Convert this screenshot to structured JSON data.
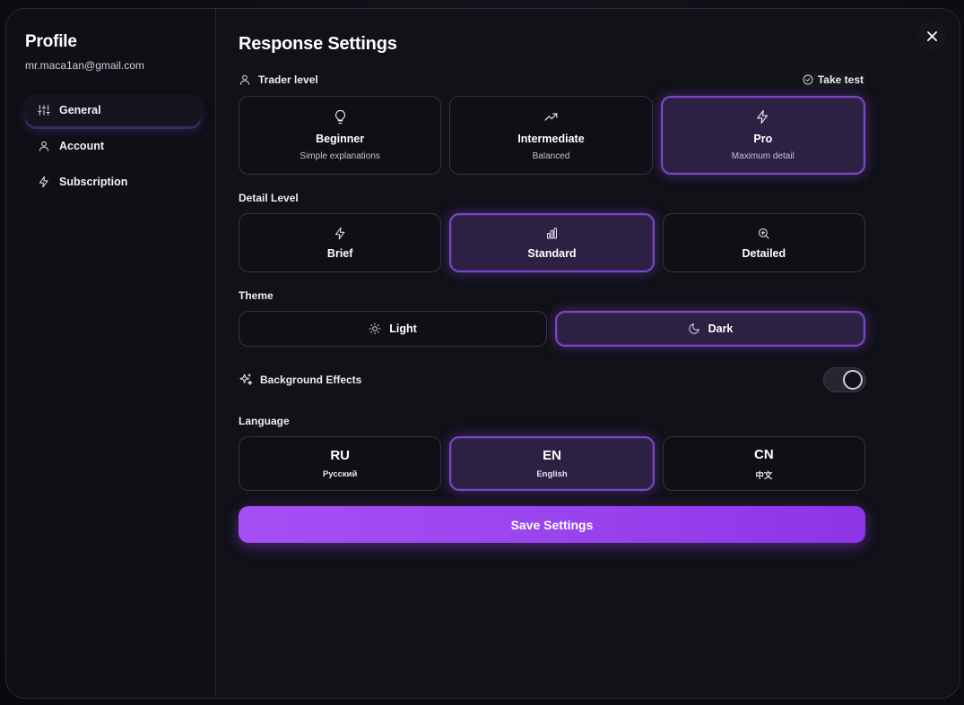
{
  "sidebar": {
    "title": "Profile",
    "email": "mr.maca1an@gmail.com",
    "items": [
      {
        "label": "General",
        "icon": "sliders-icon",
        "active": true
      },
      {
        "label": "Account",
        "icon": "user-icon",
        "active": false
      },
      {
        "label": "Subscription",
        "icon": "lightning-icon",
        "active": false
      }
    ]
  },
  "main": {
    "title": "Response Settings",
    "trader_level": {
      "label": "Trader level",
      "take_test": "Take test",
      "options": [
        {
          "title": "Beginner",
          "subtitle": "Simple explanations",
          "icon": "lightbulb-icon",
          "selected": false
        },
        {
          "title": "Intermediate",
          "subtitle": "Balanced",
          "icon": "trending-up-icon",
          "selected": false
        },
        {
          "title": "Pro",
          "subtitle": "Maximum detail",
          "icon": "lightning-icon",
          "selected": true
        }
      ]
    },
    "detail_level": {
      "label": "Detail Level",
      "options": [
        {
          "title": "Brief",
          "icon": "lightning-icon",
          "selected": false
        },
        {
          "title": "Standard",
          "icon": "bar-chart-icon",
          "selected": true
        },
        {
          "title": "Detailed",
          "icon": "zoom-in-icon",
          "selected": false
        }
      ]
    },
    "theme": {
      "label": "Theme",
      "options": [
        {
          "title": "Light",
          "icon": "sun-icon",
          "selected": false
        },
        {
          "title": "Dark",
          "icon": "moon-icon",
          "selected": true
        }
      ]
    },
    "background_effects": {
      "label": "Background Effects",
      "enabled": true
    },
    "language": {
      "label": "Language",
      "options": [
        {
          "code": "RU",
          "name": "Русский",
          "selected": false
        },
        {
          "code": "EN",
          "name": "English",
          "selected": true
        },
        {
          "code": "CN",
          "name": "中文",
          "selected": false
        }
      ]
    },
    "save_label": "Save Settings"
  },
  "colors": {
    "accent": "#9a44ee",
    "selected_bg": "#2c2142",
    "selected_border": "#7b46c9",
    "panel": "#111118"
  }
}
